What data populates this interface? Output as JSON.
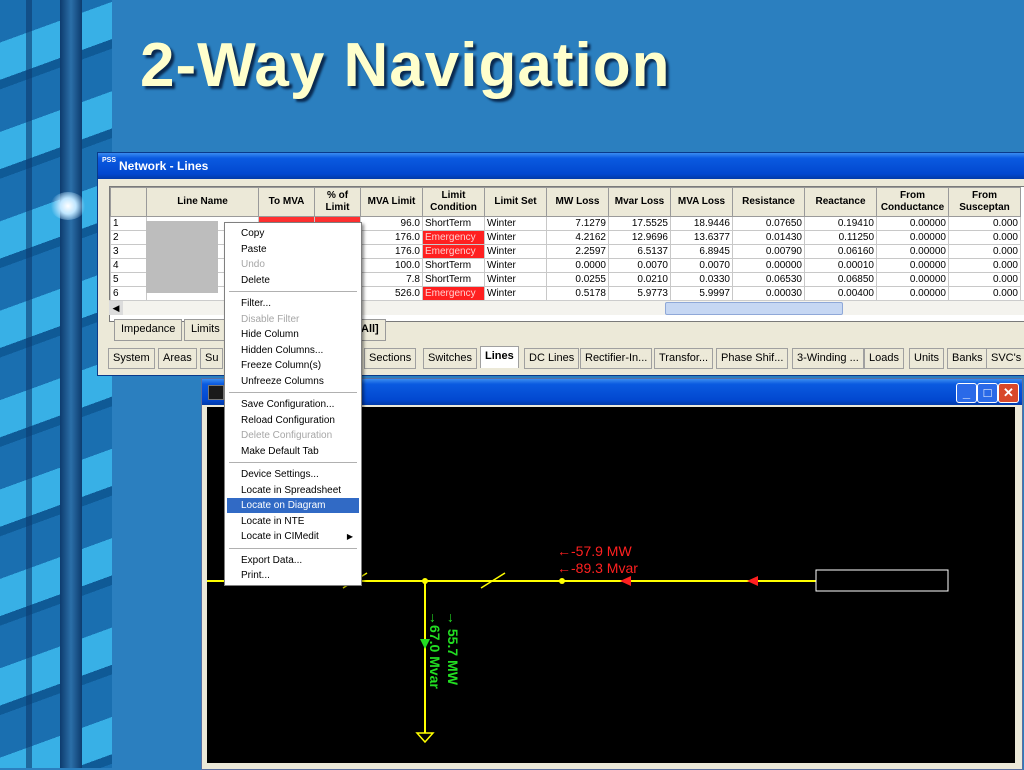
{
  "slide": {
    "title": "2-Way Navigation"
  },
  "network_window": {
    "app_icon": "PSS",
    "title": "Network - Lines",
    "columns": [
      "",
      "Line Name",
      "To MVA",
      "% of Limit",
      "MVA Limit",
      "Limit Condition",
      "Limit Set",
      "MW Loss",
      "Mvar Loss",
      "MVA Loss",
      "Resistance",
      "Reactance",
      "From Conductance",
      "From Susceptan"
    ],
    "rows": [
      [
        "1",
        "",
        "",
        "",
        "96.0",
        "ShortTerm",
        "Winter",
        "7.1279",
        "17.5525",
        "18.9446",
        "0.07650",
        "0.19410",
        "0.00000",
        "0.000"
      ],
      [
        "2",
        "",
        "",
        "",
        "176.0",
        "Emergency",
        "Winter",
        "4.2162",
        "12.9696",
        "13.6377",
        "0.01430",
        "0.11250",
        "0.00000",
        "0.000"
      ],
      [
        "3",
        "",
        "",
        "",
        "176.0",
        "Emergency",
        "Winter",
        "2.2597",
        "6.5137",
        "6.8945",
        "0.00790",
        "0.06160",
        "0.00000",
        "0.000"
      ],
      [
        "4",
        "",
        "",
        "",
        "100.0",
        "ShortTerm",
        "Winter",
        "0.0000",
        "0.0070",
        "0.0070",
        "0.00000",
        "0.00010",
        "0.00000",
        "0.000"
      ],
      [
        "5",
        "",
        "",
        "",
        "7.8",
        "ShortTerm",
        "Winter",
        "0.0255",
        "0.0210",
        "0.0330",
        "0.06530",
        "0.06850",
        "0.00000",
        "0.000"
      ],
      [
        "6",
        "",
        "",
        "",
        "526.0",
        "Emergency",
        "Winter",
        "0.5178",
        "5.9773",
        "5.9997",
        "0.00030",
        "0.00400",
        "0.00000",
        "0.000"
      ]
    ],
    "sub_tabs": [
      "Impedance",
      "Limits",
      "All]"
    ],
    "main_tabs": [
      "System",
      "Areas",
      "Su",
      "Sections",
      "Switches",
      "Lines",
      "DC Lines",
      "Rectifier-In...",
      "Transfor...",
      "Phase Shif...",
      "3-Winding ...",
      "Loads",
      "Units",
      "Banks",
      "SVC's"
    ],
    "active_tab": "Lines"
  },
  "context_menu": {
    "items": [
      {
        "label": "Copy",
        "enabled": true
      },
      {
        "label": "Paste",
        "enabled": true
      },
      {
        "label": "Undo",
        "enabled": false
      },
      {
        "label": "Delete",
        "enabled": true
      },
      {
        "sep": true
      },
      {
        "label": "Filter...",
        "enabled": true
      },
      {
        "label": "Disable Filter",
        "enabled": false
      },
      {
        "label": "Hide Column",
        "enabled": true
      },
      {
        "label": "Hidden Columns...",
        "enabled": true
      },
      {
        "label": "Freeze Column(s)",
        "enabled": true
      },
      {
        "label": "Unfreeze Columns",
        "enabled": true
      },
      {
        "sep": true
      },
      {
        "label": "Save Configuration...",
        "enabled": true
      },
      {
        "label": "Reload Configuration",
        "enabled": true
      },
      {
        "label": "Delete Configuration",
        "enabled": false
      },
      {
        "label": "Make Default Tab",
        "enabled": true
      },
      {
        "sep": true
      },
      {
        "label": "Device Settings...",
        "enabled": true
      },
      {
        "label": "Locate in Spreadsheet",
        "enabled": true
      },
      {
        "label": "Locate on Diagram",
        "enabled": true,
        "selected": true
      },
      {
        "label": "Locate in NTE",
        "enabled": true
      },
      {
        "label": "Locate in CIMedit",
        "enabled": true,
        "submenu": true
      },
      {
        "sep": true
      },
      {
        "label": "Export Data...",
        "enabled": true
      },
      {
        "label": "Print...",
        "enabled": true
      }
    ]
  },
  "diagram": {
    "mw_flow": "←-57.9 MW",
    "mvar_flow": "←-89.3 Mvar",
    "vertical_mw": "→ 55.7 MW",
    "vertical_mvar": "→67.0 Mvar",
    "colors": {
      "line": "#ffff00",
      "red_label": "#ff2020",
      "green_label": "#22dd22",
      "background": "#000000"
    }
  }
}
